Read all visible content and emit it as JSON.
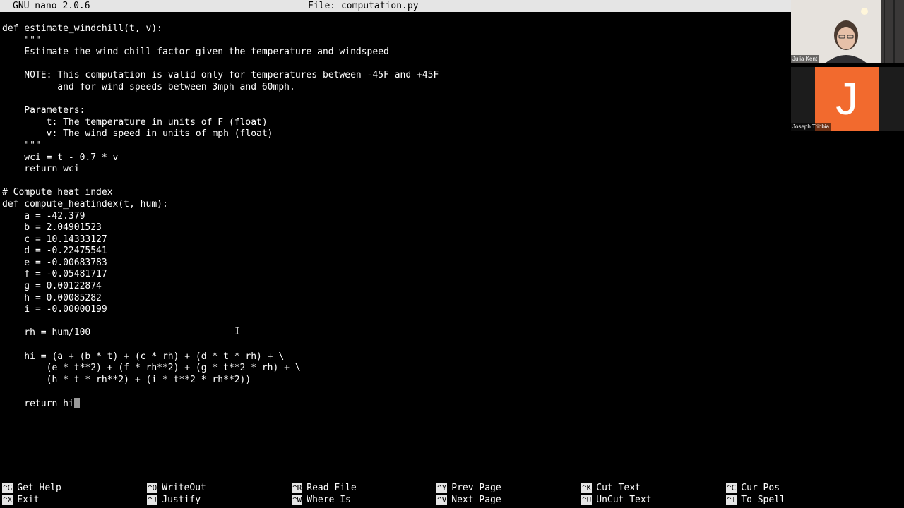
{
  "titlebar": {
    "app": "GNU nano 2.0.6",
    "file": "File: computation.py"
  },
  "code_lines": [
    "def estimate_windchill(t, v):",
    "    \"\"\"",
    "    Estimate the wind chill factor given the temperature and windspeed",
    "",
    "    NOTE: This computation is valid only for temperatures between -45F and +45F",
    "          and for wind speeds between 3mph and 60mph.",
    "",
    "    Parameters:",
    "        t: The temperature in units of F (float)",
    "        v: The wind speed in units of mph (float)",
    "    \"\"\"",
    "    wci = t - 0.7 * v",
    "    return wci",
    "",
    "# Compute heat index",
    "def compute_heatindex(t, hum):",
    "    a = -42.379",
    "    b = 2.04901523",
    "    c = 10.14333127",
    "    d = -0.22475541",
    "    e = -0.00683783",
    "    f = -0.05481717",
    "    g = 0.00122874",
    "    h = 0.00085282",
    "    i = -0.00000199",
    "",
    "    rh = hum/100",
    "",
    "    hi = (a + (b * t) + (c * rh) + (d * t * rh) + \\",
    "        (e * t**2) + (f * rh**2) + (g * t**2 * rh) + \\",
    "        (h * t * rh**2) + (i * t**2 * rh**2))",
    "",
    "    return hi"
  ],
  "shortcuts": [
    {
      "key": "^G",
      "label": "Get Help"
    },
    {
      "key": "^O",
      "label": "WriteOut"
    },
    {
      "key": "^R",
      "label": "Read File"
    },
    {
      "key": "^Y",
      "label": "Prev Page"
    },
    {
      "key": "^K",
      "label": "Cut Text"
    },
    {
      "key": "^C",
      "label": "Cur Pos"
    },
    {
      "key": "^X",
      "label": "Exit"
    },
    {
      "key": "^J",
      "label": "Justify"
    },
    {
      "key": "^W",
      "label": "Where Is"
    },
    {
      "key": "^V",
      "label": "Next Page"
    },
    {
      "key": "^U",
      "label": "UnCut Text"
    },
    {
      "key": "^T",
      "label": "To Spell"
    }
  ],
  "participants": [
    {
      "name": "Julia Kent"
    },
    {
      "name": "Joseph Tribbia",
      "initial": "J",
      "color": "#f26a2e"
    }
  ],
  "colors": {
    "terminal_bg": "#000000",
    "bar_bg": "#e5e5e5",
    "avatar_orange": "#f26a2e"
  }
}
